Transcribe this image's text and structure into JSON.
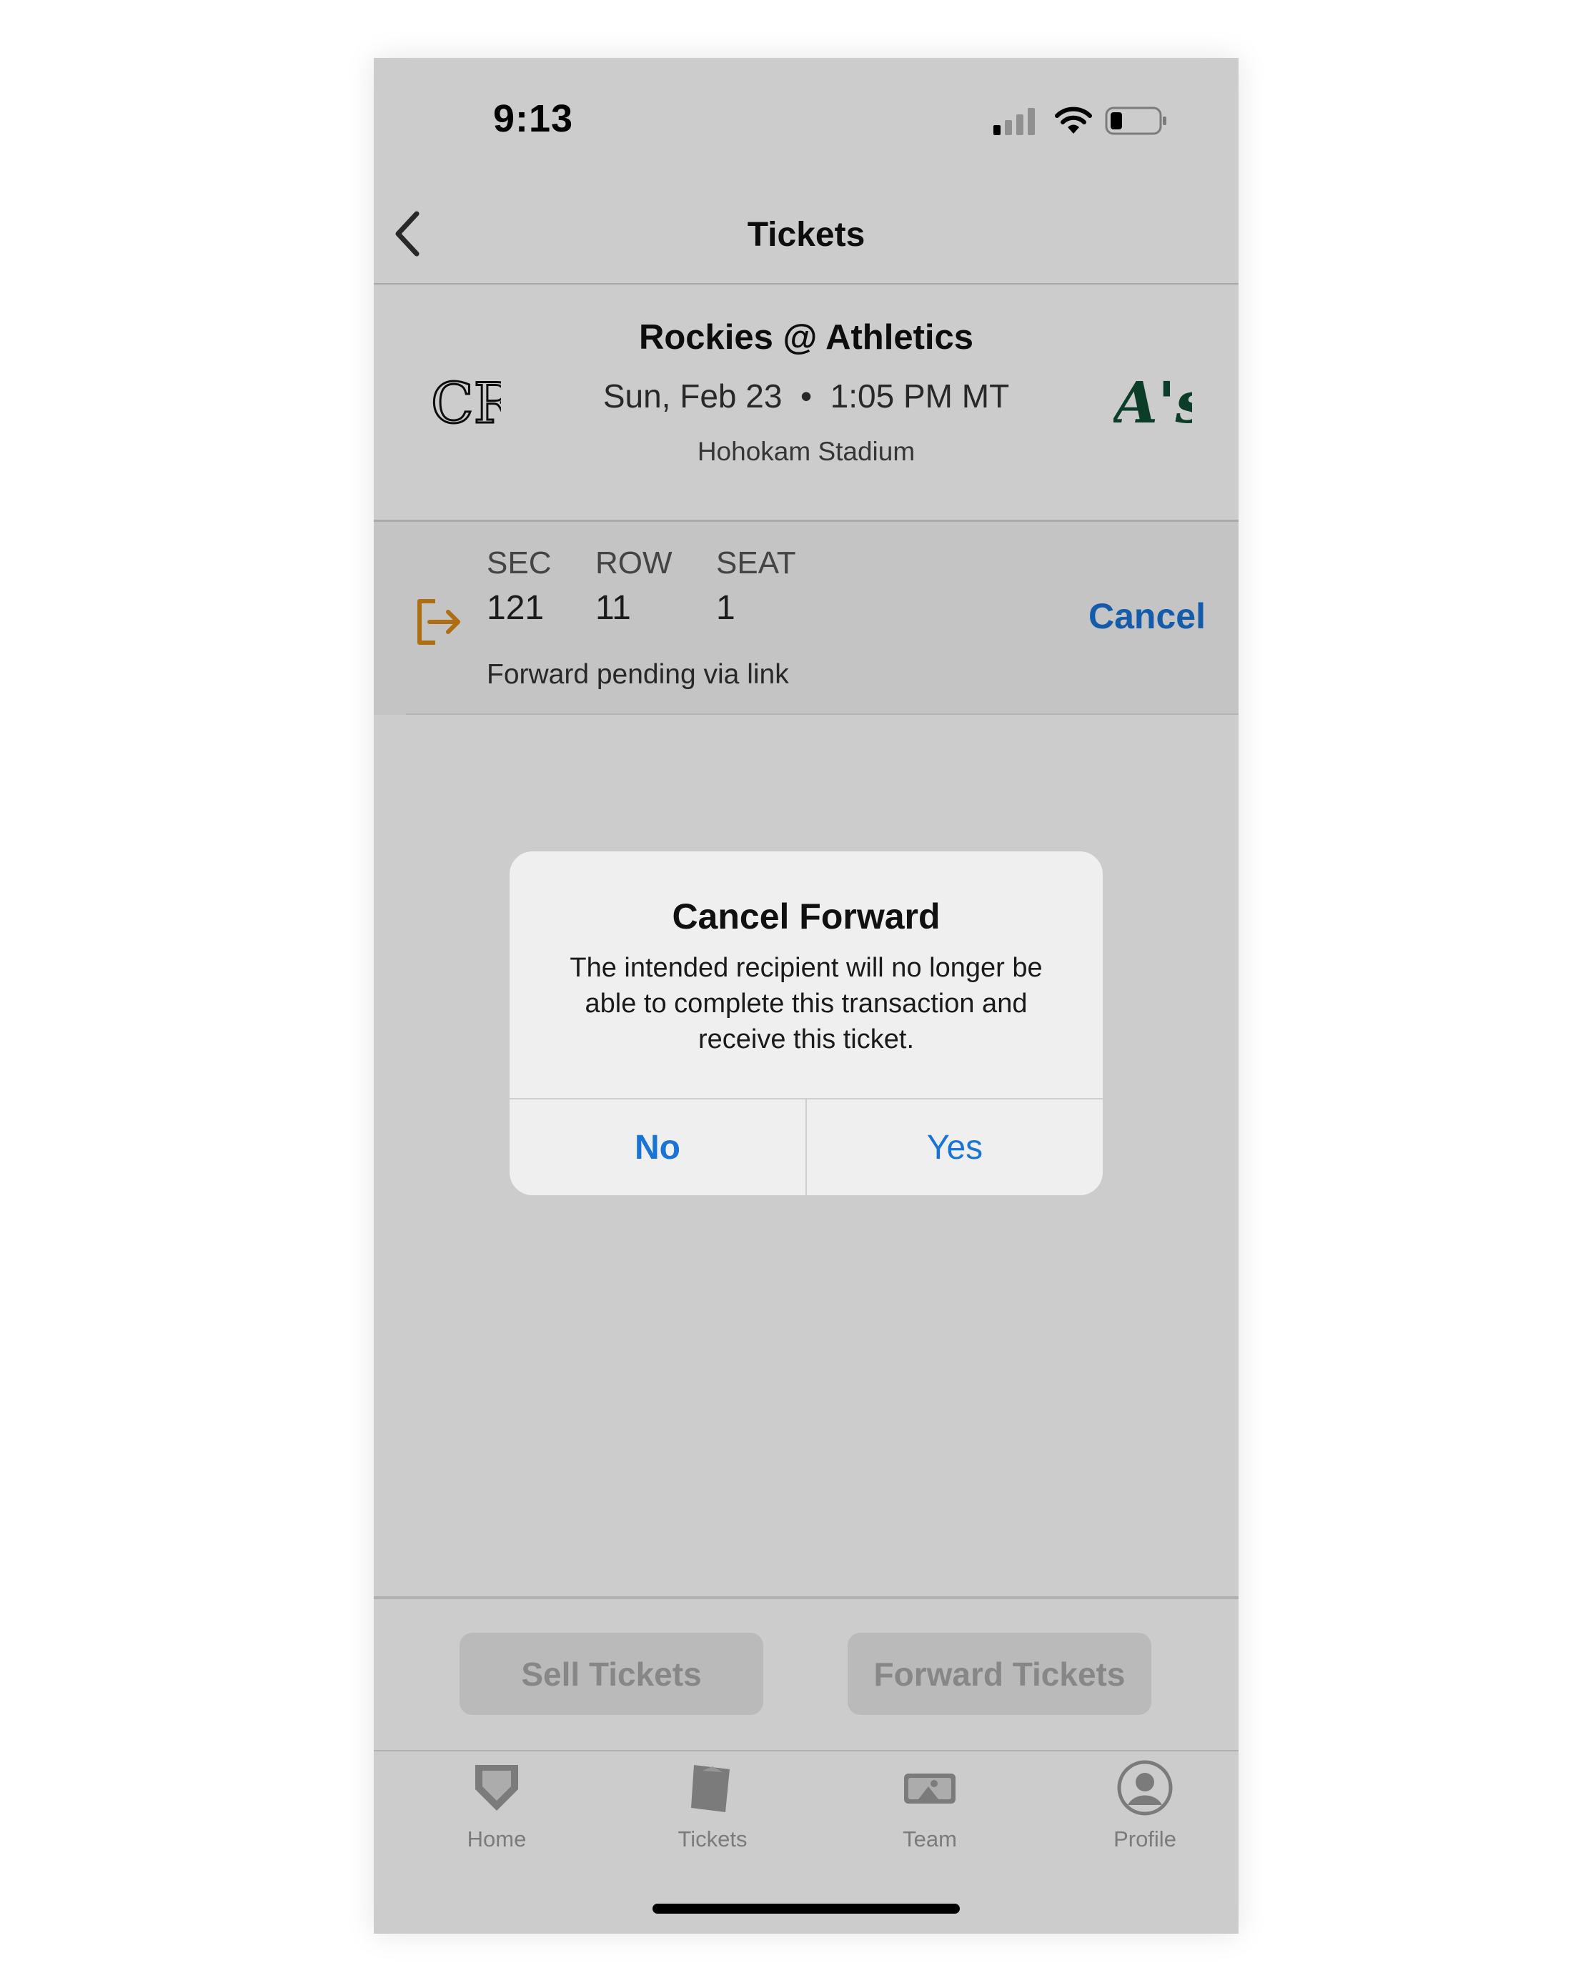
{
  "status_bar": {
    "time": "9:13"
  },
  "nav": {
    "title": "Tickets"
  },
  "event": {
    "home_team_logo": "CR",
    "away_team_logo": "A's",
    "title": "Rockies @ Athletics",
    "date_time": "Sun, Feb 23  •  1:05 PM MT",
    "venue": "Hohokam Stadium"
  },
  "ticket": {
    "sec_label": "SEC",
    "row_label": "ROW",
    "seat_label": "SEAT",
    "sec": "121",
    "row": "11",
    "seat": "1",
    "status": "Forward pending via link",
    "cancel_label": "Cancel"
  },
  "actions": {
    "sell_label": "Sell Tickets",
    "forward_label": "Forward Tickets"
  },
  "tabs": [
    {
      "label": "Home",
      "icon": "home-plate-icon"
    },
    {
      "label": "Tickets",
      "icon": "tickets-icon"
    },
    {
      "label": "Team",
      "icon": "team-icon"
    },
    {
      "label": "Profile",
      "icon": "profile-icon"
    }
  ],
  "dialog": {
    "title": "Cancel Forward",
    "message": "The intended recipient will no longer be able to complete this transaction and receive this ticket.",
    "no_label": "No",
    "yes_label": "Yes"
  },
  "colors": {
    "link_blue": "#1a73d6",
    "forward_orange": "#d98a1a",
    "athletics_green": "#0e4d34"
  }
}
